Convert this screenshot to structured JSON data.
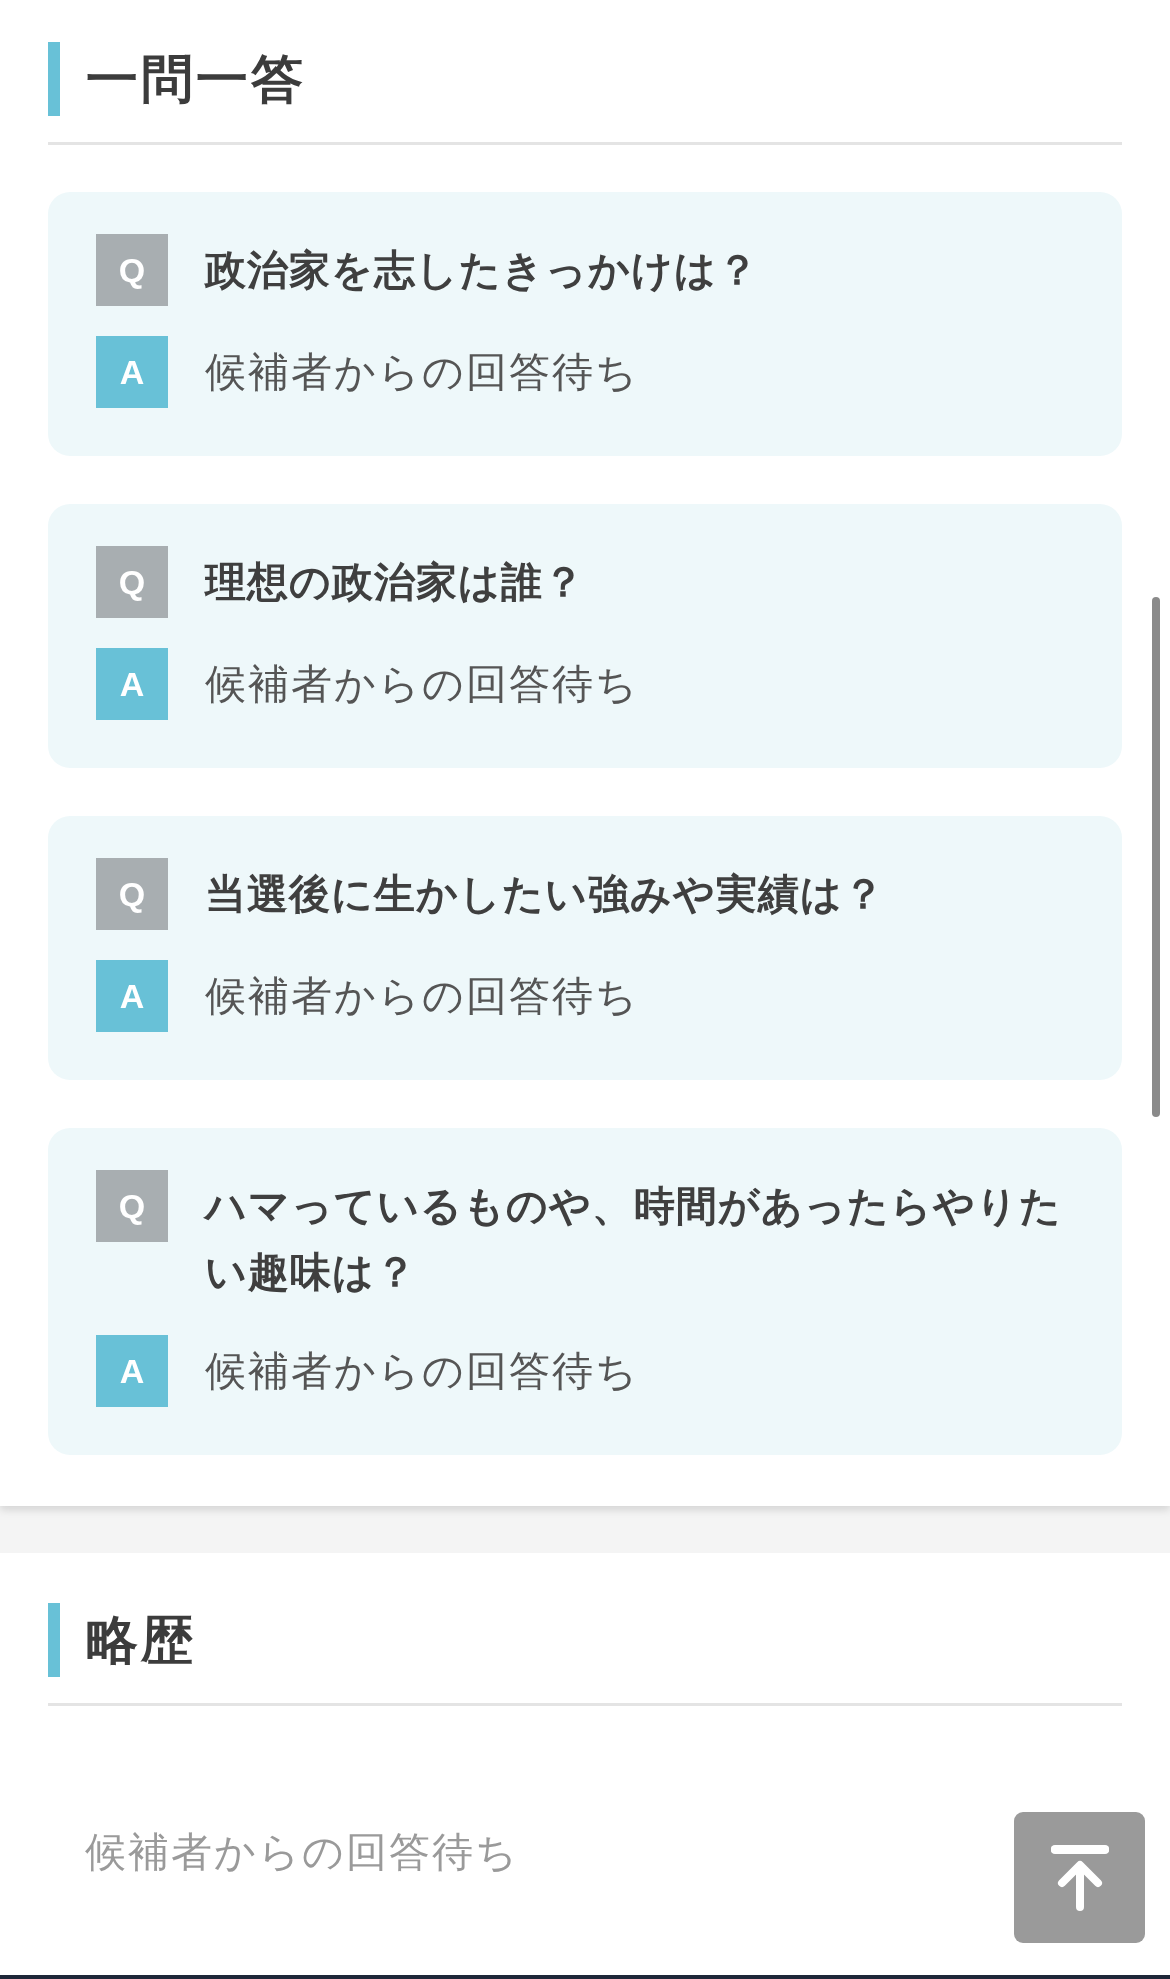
{
  "sections": [
    {
      "title": "一問一答",
      "qa": [
        {
          "q_mark": "Q",
          "question": "政治家を志したきっかけは？",
          "a_mark": "A",
          "answer": "候補者からの回答待ち"
        },
        {
          "q_mark": "Q",
          "question": "理想の政治家は誰？",
          "a_mark": "A",
          "answer": "候補者からの回答待ち"
        },
        {
          "q_mark": "Q",
          "question": "当選後に生かしたい強みや実績は？",
          "a_mark": "A",
          "answer": "候補者からの回答待ち"
        },
        {
          "q_mark": "Q",
          "question": "ハマっているものや、時間があったらやりたい趣味は？",
          "a_mark": "A",
          "answer": "候補者からの回答待ち"
        }
      ]
    },
    {
      "title": "略歴",
      "body": "候補者からの回答待ち"
    }
  ]
}
